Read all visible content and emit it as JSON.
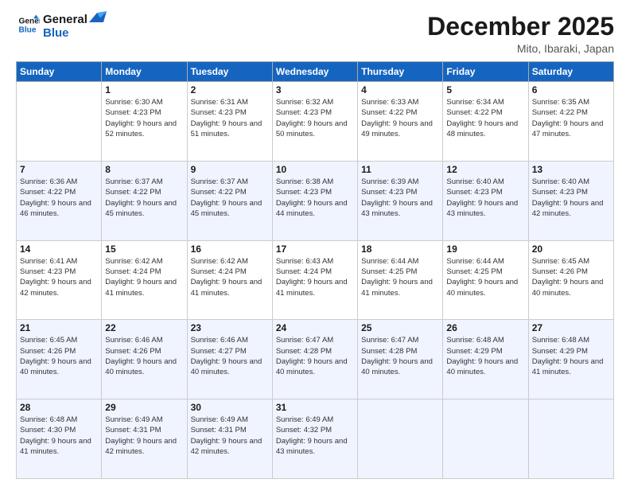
{
  "logo": {
    "line1": "General",
    "line2": "Blue"
  },
  "title": "December 2025",
  "location": "Mito, Ibaraki, Japan",
  "weekdays": [
    "Sunday",
    "Monday",
    "Tuesday",
    "Wednesday",
    "Thursday",
    "Friday",
    "Saturday"
  ],
  "weeks": [
    [
      {
        "day": "",
        "sunrise": "",
        "sunset": "",
        "daylight": ""
      },
      {
        "day": "1",
        "sunrise": "Sunrise: 6:30 AM",
        "sunset": "Sunset: 4:23 PM",
        "daylight": "Daylight: 9 hours and 52 minutes."
      },
      {
        "day": "2",
        "sunrise": "Sunrise: 6:31 AM",
        "sunset": "Sunset: 4:23 PM",
        "daylight": "Daylight: 9 hours and 51 minutes."
      },
      {
        "day": "3",
        "sunrise": "Sunrise: 6:32 AM",
        "sunset": "Sunset: 4:23 PM",
        "daylight": "Daylight: 9 hours and 50 minutes."
      },
      {
        "day": "4",
        "sunrise": "Sunrise: 6:33 AM",
        "sunset": "Sunset: 4:22 PM",
        "daylight": "Daylight: 9 hours and 49 minutes."
      },
      {
        "day": "5",
        "sunrise": "Sunrise: 6:34 AM",
        "sunset": "Sunset: 4:22 PM",
        "daylight": "Daylight: 9 hours and 48 minutes."
      },
      {
        "day": "6",
        "sunrise": "Sunrise: 6:35 AM",
        "sunset": "Sunset: 4:22 PM",
        "daylight": "Daylight: 9 hours and 47 minutes."
      }
    ],
    [
      {
        "day": "7",
        "sunrise": "Sunrise: 6:36 AM",
        "sunset": "Sunset: 4:22 PM",
        "daylight": "Daylight: 9 hours and 46 minutes."
      },
      {
        "day": "8",
        "sunrise": "Sunrise: 6:37 AM",
        "sunset": "Sunset: 4:22 PM",
        "daylight": "Daylight: 9 hours and 45 minutes."
      },
      {
        "day": "9",
        "sunrise": "Sunrise: 6:37 AM",
        "sunset": "Sunset: 4:22 PM",
        "daylight": "Daylight: 9 hours and 45 minutes."
      },
      {
        "day": "10",
        "sunrise": "Sunrise: 6:38 AM",
        "sunset": "Sunset: 4:23 PM",
        "daylight": "Daylight: 9 hours and 44 minutes."
      },
      {
        "day": "11",
        "sunrise": "Sunrise: 6:39 AM",
        "sunset": "Sunset: 4:23 PM",
        "daylight": "Daylight: 9 hours and 43 minutes."
      },
      {
        "day": "12",
        "sunrise": "Sunrise: 6:40 AM",
        "sunset": "Sunset: 4:23 PM",
        "daylight": "Daylight: 9 hours and 43 minutes."
      },
      {
        "day": "13",
        "sunrise": "Sunrise: 6:40 AM",
        "sunset": "Sunset: 4:23 PM",
        "daylight": "Daylight: 9 hours and 42 minutes."
      }
    ],
    [
      {
        "day": "14",
        "sunrise": "Sunrise: 6:41 AM",
        "sunset": "Sunset: 4:23 PM",
        "daylight": "Daylight: 9 hours and 42 minutes."
      },
      {
        "day": "15",
        "sunrise": "Sunrise: 6:42 AM",
        "sunset": "Sunset: 4:24 PM",
        "daylight": "Daylight: 9 hours and 41 minutes."
      },
      {
        "day": "16",
        "sunrise": "Sunrise: 6:42 AM",
        "sunset": "Sunset: 4:24 PM",
        "daylight": "Daylight: 9 hours and 41 minutes."
      },
      {
        "day": "17",
        "sunrise": "Sunrise: 6:43 AM",
        "sunset": "Sunset: 4:24 PM",
        "daylight": "Daylight: 9 hours and 41 minutes."
      },
      {
        "day": "18",
        "sunrise": "Sunrise: 6:44 AM",
        "sunset": "Sunset: 4:25 PM",
        "daylight": "Daylight: 9 hours and 41 minutes."
      },
      {
        "day": "19",
        "sunrise": "Sunrise: 6:44 AM",
        "sunset": "Sunset: 4:25 PM",
        "daylight": "Daylight: 9 hours and 40 minutes."
      },
      {
        "day": "20",
        "sunrise": "Sunrise: 6:45 AM",
        "sunset": "Sunset: 4:26 PM",
        "daylight": "Daylight: 9 hours and 40 minutes."
      }
    ],
    [
      {
        "day": "21",
        "sunrise": "Sunrise: 6:45 AM",
        "sunset": "Sunset: 4:26 PM",
        "daylight": "Daylight: 9 hours and 40 minutes."
      },
      {
        "day": "22",
        "sunrise": "Sunrise: 6:46 AM",
        "sunset": "Sunset: 4:26 PM",
        "daylight": "Daylight: 9 hours and 40 minutes."
      },
      {
        "day": "23",
        "sunrise": "Sunrise: 6:46 AM",
        "sunset": "Sunset: 4:27 PM",
        "daylight": "Daylight: 9 hours and 40 minutes."
      },
      {
        "day": "24",
        "sunrise": "Sunrise: 6:47 AM",
        "sunset": "Sunset: 4:28 PM",
        "daylight": "Daylight: 9 hours and 40 minutes."
      },
      {
        "day": "25",
        "sunrise": "Sunrise: 6:47 AM",
        "sunset": "Sunset: 4:28 PM",
        "daylight": "Daylight: 9 hours and 40 minutes."
      },
      {
        "day": "26",
        "sunrise": "Sunrise: 6:48 AM",
        "sunset": "Sunset: 4:29 PM",
        "daylight": "Daylight: 9 hours and 40 minutes."
      },
      {
        "day": "27",
        "sunrise": "Sunrise: 6:48 AM",
        "sunset": "Sunset: 4:29 PM",
        "daylight": "Daylight: 9 hours and 41 minutes."
      }
    ],
    [
      {
        "day": "28",
        "sunrise": "Sunrise: 6:48 AM",
        "sunset": "Sunset: 4:30 PM",
        "daylight": "Daylight: 9 hours and 41 minutes."
      },
      {
        "day": "29",
        "sunrise": "Sunrise: 6:49 AM",
        "sunset": "Sunset: 4:31 PM",
        "daylight": "Daylight: 9 hours and 42 minutes."
      },
      {
        "day": "30",
        "sunrise": "Sunrise: 6:49 AM",
        "sunset": "Sunset: 4:31 PM",
        "daylight": "Daylight: 9 hours and 42 minutes."
      },
      {
        "day": "31",
        "sunrise": "Sunrise: 6:49 AM",
        "sunset": "Sunset: 4:32 PM",
        "daylight": "Daylight: 9 hours and 43 minutes."
      },
      {
        "day": "",
        "sunrise": "",
        "sunset": "",
        "daylight": ""
      },
      {
        "day": "",
        "sunrise": "",
        "sunset": "",
        "daylight": ""
      },
      {
        "day": "",
        "sunrise": "",
        "sunset": "",
        "daylight": ""
      }
    ]
  ]
}
